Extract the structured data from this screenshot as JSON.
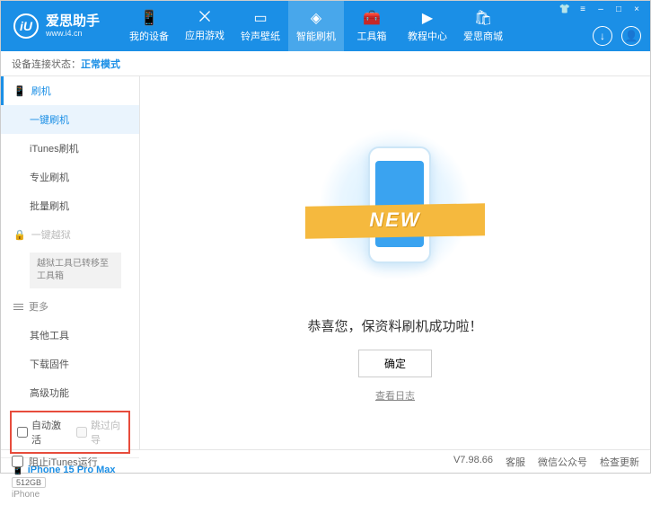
{
  "header": {
    "logo_letter": "iU",
    "app_name": "爱思助手",
    "site_url": "www.i4.cn",
    "nav": [
      {
        "icon": "📱",
        "label": "我的设备"
      },
      {
        "icon": "⨉",
        "label": "应用游戏"
      },
      {
        "icon": "▭",
        "label": "铃声壁纸"
      },
      {
        "icon": "◈",
        "label": "智能刷机"
      },
      {
        "icon": "🧰",
        "label": "工具箱"
      },
      {
        "icon": "▶",
        "label": "教程中心"
      },
      {
        "icon": "🛍",
        "label": "爱思商城"
      }
    ]
  },
  "status": {
    "label": "设备连接状态：",
    "mode": "正常模式"
  },
  "sidebar": {
    "flash_group": "刷机",
    "items_flash": [
      "一键刷机",
      "iTunes刷机",
      "专业刷机",
      "批量刷机"
    ],
    "jailbreak_group": "一键越狱",
    "jailbreak_note": "越狱工具已转移至工具箱",
    "more_group": "更多",
    "items_more": [
      "其他工具",
      "下载固件",
      "高级功能"
    ],
    "cb_auto_activate": "自动激活",
    "cb_skip_guide": "跳过向导",
    "device": {
      "name": "iPhone 15 Pro Max",
      "capacity": "512GB",
      "type": "iPhone"
    }
  },
  "main": {
    "ribbon": "NEW",
    "success": "恭喜您，保资料刷机成功啦！",
    "ok": "确定",
    "log": "查看日志"
  },
  "footer": {
    "block_itunes": "阻止iTunes运行",
    "version": "V7.98.66",
    "links": [
      "客服",
      "微信公众号",
      "检查更新"
    ]
  }
}
